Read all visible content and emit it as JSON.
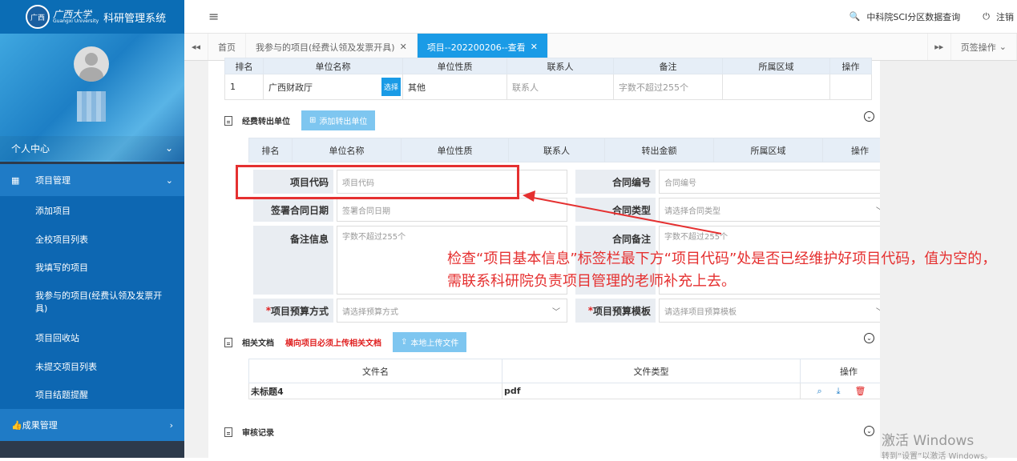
{
  "app": {
    "logo_seal": "广西",
    "logo_cn": "广西大学",
    "logo_en": "Guangxi University",
    "system_name": "科研管理系统"
  },
  "sidebar": {
    "profile_menu": "个人中心",
    "group_label": "项目管理",
    "items": [
      {
        "label": "添加项目"
      },
      {
        "label": "全校项目列表"
      },
      {
        "label": "我填写的项目"
      },
      {
        "label": "我参与的项目(经费认领及发票开具)"
      },
      {
        "label": "项目回收站"
      },
      {
        "label": "未提交项目列表"
      },
      {
        "label": "项目结题提醒"
      }
    ],
    "footer_label": "成果管理"
  },
  "topbar": {
    "query_label": "中科院SCI分区数据查询",
    "logout_label": "注销"
  },
  "tabs": [
    {
      "label": "首页"
    },
    {
      "label": "我参与的项目(经费认领及发票开具)"
    },
    {
      "label": "项目--202200206--查看"
    }
  ],
  "page_ops_label": "页签操作",
  "unit_table": {
    "headers": [
      "排名",
      "单位名称",
      "单位性质",
      "联系人",
      "备注",
      "所属区域",
      "操作"
    ],
    "row": {
      "rank": "1",
      "name": "广西财政厅",
      "select_btn": "选择",
      "nature": "其他",
      "contact_placeholder": "联系人",
      "note_placeholder": "字数不超过255个"
    }
  },
  "transfer_section": {
    "title": "经费转出单位",
    "add_btn": "添加转出单位",
    "headers": [
      "排名",
      "单位名称",
      "单位性质",
      "联系人",
      "转出金额",
      "所属区域",
      "操作"
    ]
  },
  "form": {
    "project_code_label": "项目代码",
    "project_code_placeholder": "项目代码",
    "contract_no_label": "合同编号",
    "contract_no_placeholder": "合同编号",
    "sign_date_label": "签署合同日期",
    "sign_date_placeholder": "签署合同日期",
    "contract_type_label": "合同类型",
    "contract_type_placeholder": "请选择合同类型",
    "remark_label": "备注信息",
    "remark_placeholder": "字数不超过255个",
    "contract_remark_label": "合同备注",
    "contract_remark_placeholder": "字数不超过255个",
    "budget_mode_label": "项目预算方式",
    "budget_mode_placeholder": "请选择预算方式",
    "budget_tpl_label": "项目预算模板",
    "budget_tpl_placeholder": "请选择项目预算模板"
  },
  "docs_section": {
    "title": "相关文档",
    "warning": "横向项目必须上传相关文档",
    "upload_btn": "本地上传文件",
    "headers": [
      "文件名",
      "文件类型",
      "操作"
    ],
    "row": {
      "name": "未标题4",
      "type": "pdf"
    }
  },
  "audit_section": {
    "title": "审核记录"
  },
  "annotation": "检查“项目基本信息”标签栏最下方“项目代码”处是否已经维护好项目代码，值为空的，需联系科研院负责项目管理的老师补充上去。",
  "watermark": {
    "line1": "激活 Windows",
    "line2": "转到“设置”以激活 Windows。"
  },
  "colors": {
    "accent": "#1a9be6",
    "annotation": "#e53030",
    "sidebar_active": "#1f7bc6"
  }
}
